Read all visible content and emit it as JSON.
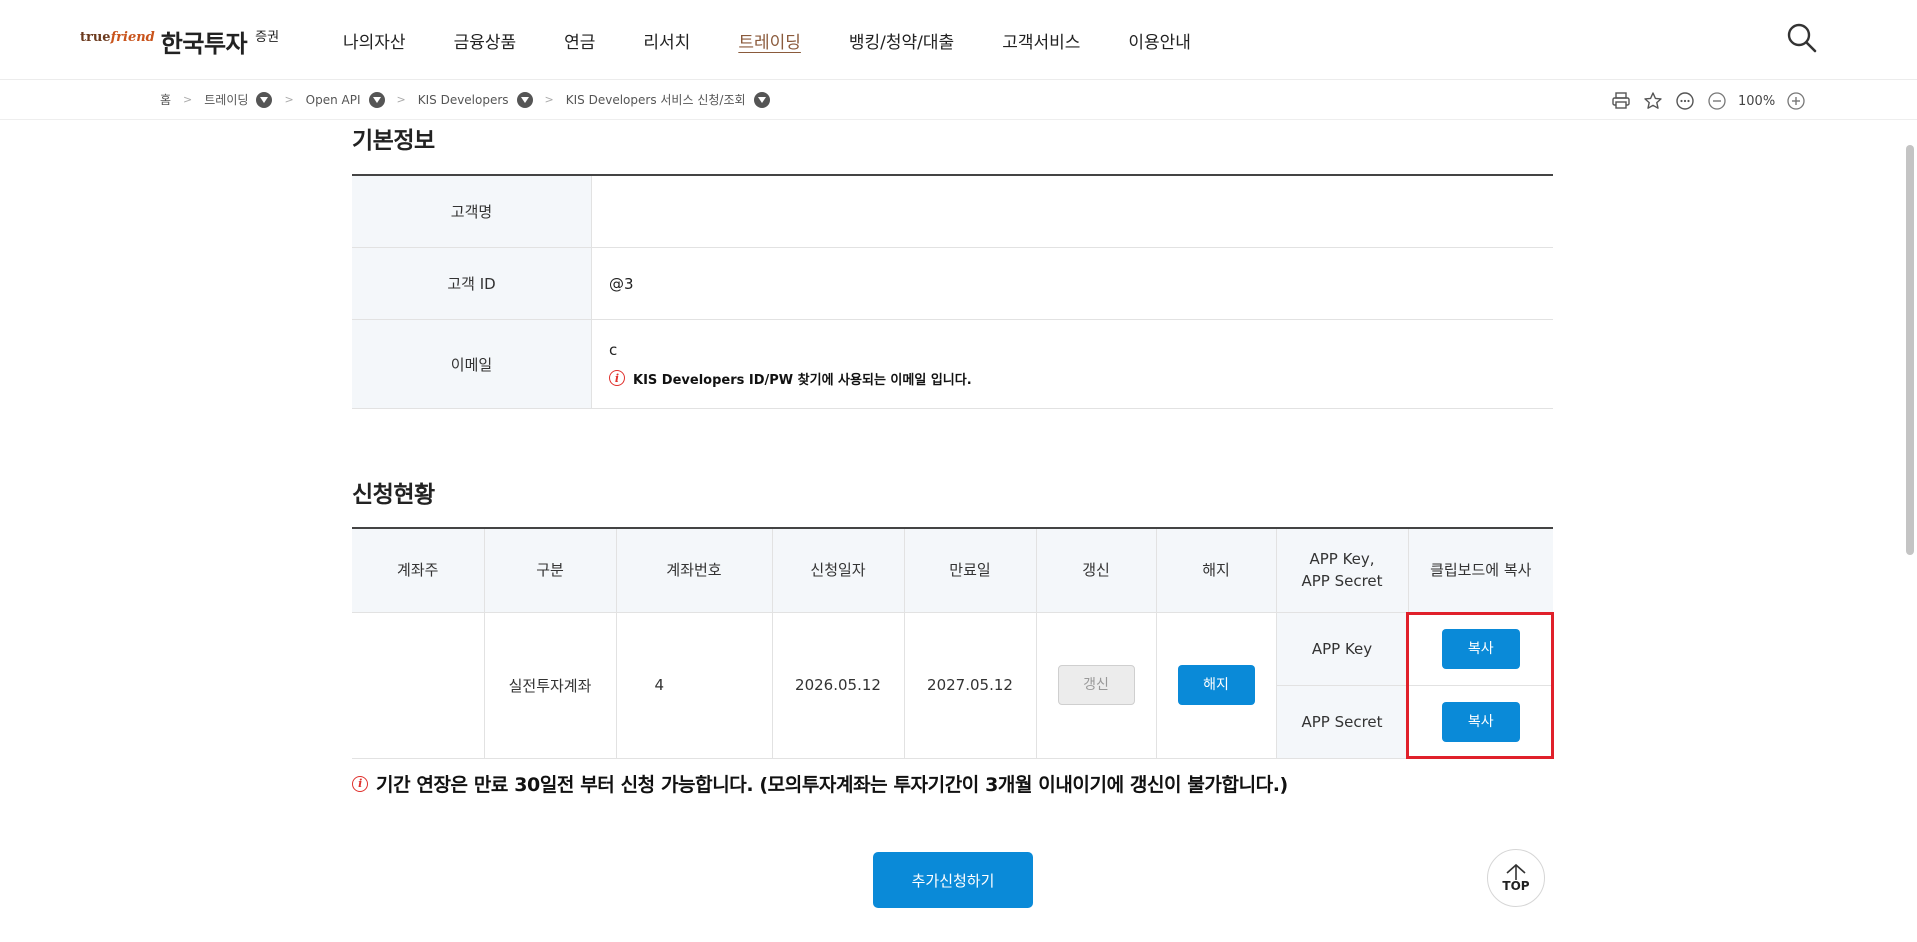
{
  "header": {
    "logo_tf_a": "true",
    "logo_tf_b": "friend",
    "logo_name": "한국투자",
    "logo_sub": "증권",
    "nav": [
      "나의자산",
      "금융상품",
      "연금",
      "리서치",
      "트레이딩",
      "뱅킹/청약/대출",
      "고객서비스",
      "이용안내"
    ],
    "active_nav": "트레이딩",
    "search_icon": "search-icon"
  },
  "breadcrumb": {
    "items": [
      "홈",
      "트레이딩",
      "Open API",
      "KIS Developers",
      "KIS Developers 서비스 신청/조회"
    ],
    "zoom": "100%"
  },
  "basic_info": {
    "title": "기본정보",
    "rows": [
      {
        "label": "고객명",
        "value": ""
      },
      {
        "label": "고객 ID",
        "value": "@3"
      },
      {
        "label": "이메일",
        "value": "c"
      }
    ],
    "email_notice": "KIS Developers ID/PW 찾기에 사용되는 이메일 입니다."
  },
  "status": {
    "title": "신청현황",
    "headers": {
      "owner": "계좌주",
      "type": "구분",
      "account": "계좌번호",
      "applied": "신청일자",
      "expires": "만료일",
      "renew": "갱신",
      "cancel": "해지",
      "key_l1": "APP Key,",
      "key_l2": "APP Secret",
      "copy": "클립보드에 복사"
    },
    "row": {
      "owner": "",
      "type": "실전투자계좌",
      "account": "4",
      "applied": "2026.05.12",
      "expires": "2027.05.12",
      "renew_btn": "갱신",
      "cancel_btn": "해지",
      "app_key": "APP Key",
      "app_secret": "APP Secret",
      "copy_btn": "복사"
    },
    "notice": "기간 연장은 만료 30일전 부터 신청 가능합니다. (모의투자계좌는 투자기간이 3개월 이내이기에 갱신이 불가합니다.)"
  },
  "actions": {
    "add_apply": "추가신청하기",
    "top": "TOP"
  },
  "colors": {
    "primary": "#0a8ad8",
    "highlight": "#e0202a",
    "brand": "#6b3a1e"
  }
}
